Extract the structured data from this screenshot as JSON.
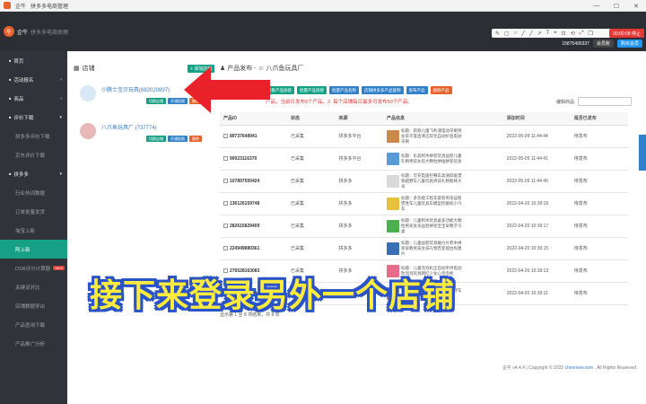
{
  "window": {
    "title": "企牛",
    "subtitle": "拼多多电商管理",
    "controls": [
      "—",
      "☐",
      "✕"
    ]
  },
  "brand": {
    "name": "企牛",
    "tagline": "拼多多电商助理"
  },
  "toolbar": {
    "icons": [
      "✎",
      "▢",
      "○",
      "╱",
      "╱",
      "↗",
      "T",
      "⌖",
      "⊡",
      "⟲",
      "⤢",
      "❐"
    ],
    "rec": "00:00:08 停止"
  },
  "user": {
    "phone": "15875495337",
    "role": "会员账",
    "buy": "购买会员"
  },
  "sidebar": [
    {
      "label": "首页",
      "icon": "home-icon",
      "kind": "grp"
    },
    {
      "label": "活动报名",
      "icon": "flag-icon",
      "kind": "grp",
      "arrow": "‹"
    },
    {
      "label": "商品",
      "icon": "box-icon",
      "kind": "grp",
      "arrow": "‹"
    },
    {
      "label": "评价下载",
      "icon": "download-icon",
      "kind": "grp",
      "arrow": "▾"
    },
    {
      "label": "拼多多评价下载",
      "kind": "sub"
    },
    {
      "label": "京东评价下载",
      "kind": "sub"
    },
    {
      "label": "拼多多",
      "icon": "cart-icon",
      "kind": "grp",
      "arrow": "▾"
    },
    {
      "label": "行业热词数据",
      "kind": "sub"
    },
    {
      "label": "订单批量发货",
      "kind": "sub"
    },
    {
      "label": "淘宝上新",
      "kind": "sub"
    },
    {
      "label": "阿上新",
      "kind": "sub",
      "active": true
    },
    {
      "label": "DSR评分计算器",
      "kind": "sub",
      "badge": "NEW"
    },
    {
      "label": "关键词对比",
      "kind": "sub"
    },
    {
      "label": "店铺数据导出",
      "kind": "sub"
    },
    {
      "label": "产品查询下载",
      "kind": "sub"
    },
    {
      "label": "产品推广分析",
      "kind": "sub"
    }
  ],
  "shops": {
    "title": "店铺",
    "add": "+ 添加店铺",
    "list": [
      {
        "name": "小腾士宝贝玩具(682020897)",
        "btn1": "切换店铺",
        "btn2": "开通权限",
        "btn3": "删除",
        "avatar": "#d9e8f5"
      },
      {
        "name": "八爪鱼玩具厂 (737774)",
        "btn1": "切换店铺",
        "btn2": "开通权限",
        "btn3": "删除",
        "avatar": "#e8b8b8"
      }
    ]
  },
  "publish": {
    "title": "产品发布 - ☺ 八爪鱼玩具厂",
    "actions": [
      {
        "label": "采集产品链接",
        "color": "#16a085"
      },
      {
        "label": "批量产品链接",
        "color": "#16a085"
      },
      {
        "label": "批量产品名称",
        "color": "#2f80c9"
      },
      {
        "label": "店铺拼多多产品复制",
        "color": "#2f80c9"
      },
      {
        "label": "发布产品",
        "color": "#2f80c9"
      },
      {
        "label": "删除产品",
        "color": "#e8632b"
      }
    ],
    "notice": "产品，当前日发布5个产品，2. 每个店铺每日最多可发布50个产品。",
    "search_label": "编辑商品:"
  },
  "table": {
    "headers": [
      "产品ID",
      "状态",
      "来源",
      "产品信息",
      "添加时间",
      "是否已发布"
    ],
    "rows": [
      {
        "id": "89737648941",
        "status": "已采集",
        "source": "拼多多平台",
        "info": "标题：新款儿童飞利浦电动牙刷男女孩子度齿清洁软毛自动护齿电动牙刷",
        "time": "2022-05-09 11:44:44",
        "pub": "待发布",
        "thumb": "#c98a4a"
      },
      {
        "id": "90023116370",
        "status": "已采集",
        "source": "拼多多平台",
        "info": "标题：乐高积木拼装玩具益智儿童礼物男孩女孩大颗粒拼插拼装玩具",
        "time": "2022-05-09 11:44:41",
        "pub": "待发布",
        "thumb": "#5a9bd6"
      },
      {
        "id": "107897550424",
        "status": "已采集",
        "source": "拼多多",
        "info": "标题：可充电遥控赛车高速四驱漂移越野车儿童玩具男孩礼物耐摔大号",
        "time": "2022-05-09 11:44:40",
        "pub": "待发布",
        "thumb": "#d9d9d9"
      },
      {
        "id": "136126159748",
        "status": "已采集",
        "source": "拼多多",
        "info": "标题：多功能工程车套装男孩益智惯性车儿童玩具车模型挖掘机小汽车",
        "time": "2022-04-20 10:39:19",
        "pub": "待发布",
        "thumb": "#e6c23c"
      },
      {
        "id": "282615829409",
        "status": "已采集",
        "source": "拼多多",
        "info": "标题：儿童积木玩具桌多功能大颗粒男孩女孩益智拼装宝宝早教学习桌",
        "time": "2022-04-20 10:39:17",
        "pub": "待发布",
        "thumb": "#4caf50"
      },
      {
        "id": "224949880361",
        "status": "已采集",
        "source": "拼多多",
        "info": "标题：儿童益智玩具磁力片积木拼装早教男孩女孩礼物百变提拉构建片",
        "time": "2022-04-20 10:39:15",
        "pub": "待发布",
        "thumb": "#3a6fb5"
      },
      {
        "id": "276528163083",
        "status": "已采集",
        "source": "拼多多",
        "info": "标题：儿童泡泡机全自动手持电动吹泡泡玩具网红少女心泡泡枪",
        "time": "2022-04-20 10:39:13",
        "pub": "待发布",
        "thumb": "#e86b8a"
      },
      {
        "id": "279416725301",
        "status": "已采集",
        "source": "拼多多",
        "info": "标题：儿童电动遥控车充电越野车男孩玩具",
        "time": "2022-04-20 10:39:11",
        "pub": "待发布",
        "thumb": "#888888"
      }
    ]
  },
  "pager": "显示第 1 至 8 项结果，共 8 项",
  "footer": {
    "ver": "企牛 v4.4.4",
    "copy": "| Copyright © 2022",
    "site": "chenniew.com",
    "rights": ". All Rights Reserved"
  },
  "caption": "接下来登录另外一个店铺",
  "colors": {
    "accent": "#16a085",
    "sidebar": "#30343a",
    "arrow": "#e8212b",
    "caption": "#ffeb3b",
    "caption_outline": "#2a53c8"
  }
}
